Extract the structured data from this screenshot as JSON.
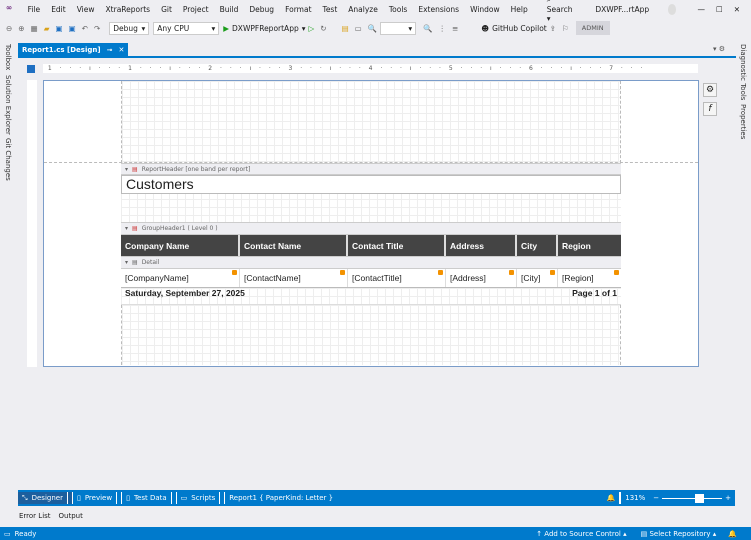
{
  "menu": [
    "File",
    "Edit",
    "View",
    "XtraReports",
    "Git",
    "Project",
    "Build",
    "Debug",
    "Format",
    "Test",
    "Analyze",
    "Tools",
    "Extensions",
    "Window",
    "Help"
  ],
  "search_label": "Search",
  "solution_name": "DXWPF...rtApp",
  "toolbar": {
    "config": "Debug",
    "platform": "Any CPU",
    "run_target": "DXWPFReportApp",
    "copilot": "GitHub Copilot",
    "admin": "ADMIN"
  },
  "doc_tab": "Report1.cs [Design]",
  "left_tabs": [
    "Toolbox",
    "Solution Explorer",
    "Git Changes"
  ],
  "right_tabs": [
    "Diagnostic Tools",
    "Properties"
  ],
  "report": {
    "report_header_band": "ReportHeader [one band per report]",
    "title": "Customers",
    "group_header_band": "GroupHeader1 ( Level 0 )",
    "columns": [
      "Company Name",
      "Contact Name",
      "Contact Title",
      "Address",
      "City",
      "Region"
    ],
    "detail_band": "Detail",
    "fields": [
      "[CompanyName]",
      "[ContactName]",
      "[ContactTitle]",
      "[Address]",
      "[City]",
      "[Region]"
    ],
    "date": "Saturday, September 27, 2025",
    "page": "Page 1 of 1"
  },
  "designer_bar": {
    "tabs": [
      "Designer",
      "Preview",
      "Test Data",
      "Scripts"
    ],
    "info": "Report1 { PaperKind: Letter }",
    "zoom": "131%",
    "zoom_level": 0.55
  },
  "tool_windows": [
    "Error List",
    "Output"
  ],
  "status": {
    "ready": "Ready",
    "source_control": "Add to Source Control",
    "repository": "Select Repository"
  }
}
